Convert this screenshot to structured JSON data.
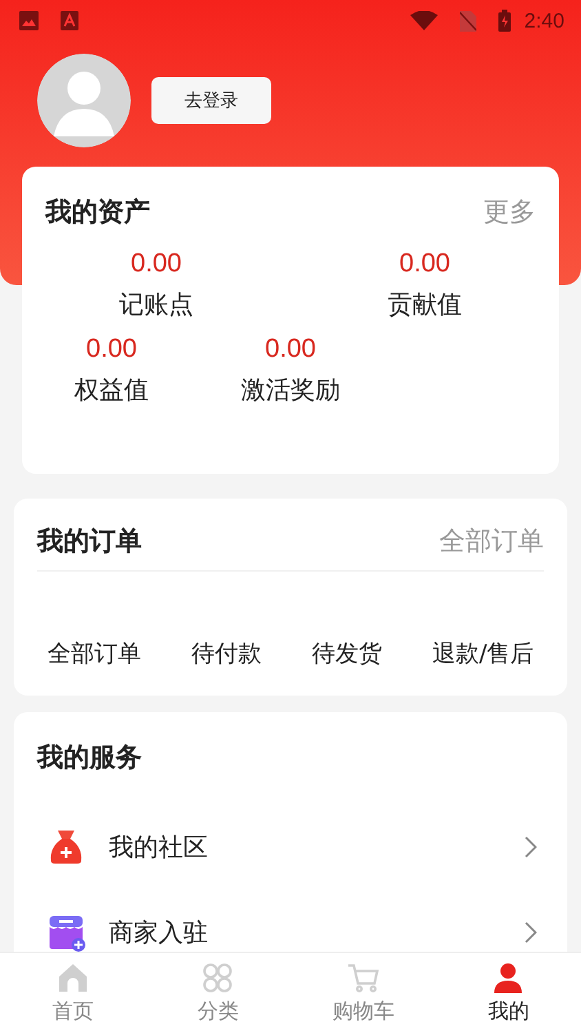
{
  "status_bar": {
    "time": "2:40"
  },
  "profile": {
    "login_button": "去登录"
  },
  "assets": {
    "title": "我的资产",
    "more": "更多",
    "items": [
      {
        "value": "0.00",
        "label": "记账点"
      },
      {
        "value": "0.00",
        "label": "贡献值"
      },
      {
        "value": "0.00",
        "label": "权益值"
      },
      {
        "value": "0.00",
        "label": "激活奖励"
      }
    ]
  },
  "orders": {
    "title": "我的订单",
    "more": "全部订单",
    "items": [
      "全部订单",
      "待付款",
      "待发货",
      "退款/售后"
    ]
  },
  "services": {
    "title": "我的服务",
    "items": [
      {
        "kind": "community",
        "label": "我的社区"
      },
      {
        "kind": "merchant",
        "label": "商家入驻"
      }
    ]
  },
  "tabs": [
    {
      "kind": "home",
      "label": "首页",
      "selected": false
    },
    {
      "kind": "category",
      "label": "分类",
      "selected": false
    },
    {
      "kind": "cart",
      "label": "购物车",
      "selected": false
    },
    {
      "kind": "me",
      "label": "我的",
      "selected": true
    }
  ]
}
